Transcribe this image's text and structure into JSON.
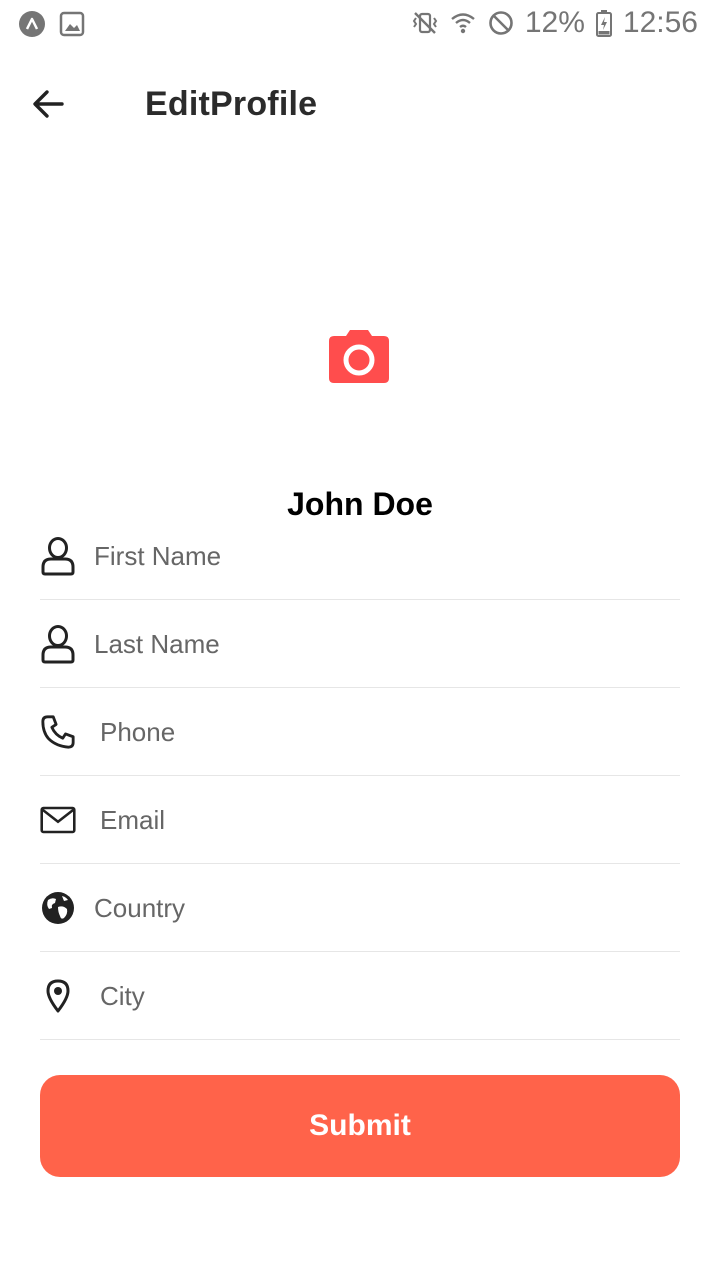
{
  "status_bar": {
    "battery": "12%",
    "time": "12:56",
    "icons": [
      "app-notification-icon",
      "image-notification-icon",
      "vibrate-icon",
      "wifi-icon",
      "blocked-icon",
      "battery-icon"
    ]
  },
  "header": {
    "title": "EditProfile",
    "back_icon": "arrow-left-icon"
  },
  "profile": {
    "name": "John Doe",
    "avatar_icon": "camera-icon",
    "accent_color": "#ff4d4d"
  },
  "form": {
    "fields": [
      {
        "placeholder": "First Name",
        "value": "",
        "icon": "user-icon"
      },
      {
        "placeholder": "Last Name",
        "value": "",
        "icon": "user-icon"
      },
      {
        "placeholder": "Phone",
        "value": "",
        "icon": "phone-icon"
      },
      {
        "placeholder": "Email",
        "value": "",
        "icon": "envelope-icon"
      },
      {
        "placeholder": "Country",
        "value": "",
        "icon": "globe-icon"
      },
      {
        "placeholder": "City",
        "value": "",
        "icon": "map-pin-icon"
      }
    ]
  },
  "submit": {
    "label": "Submit",
    "color": "#ff634a"
  }
}
